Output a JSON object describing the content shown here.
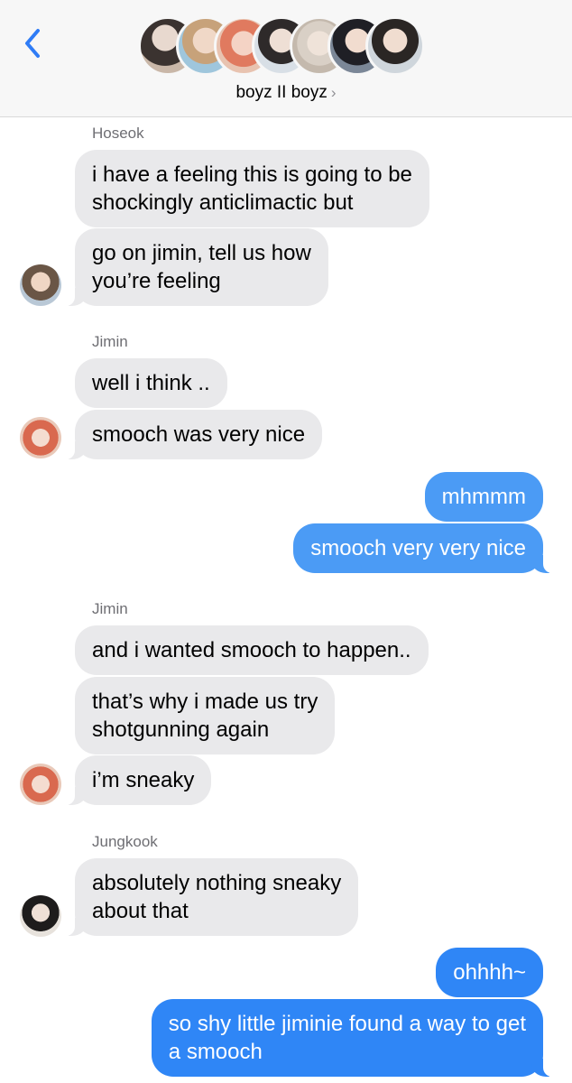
{
  "header": {
    "group_name": "boyz II boyz",
    "chevron": "›",
    "member_count": 7
  },
  "messages": [
    {
      "sender": "Hoseok",
      "text": "i have a feeling this is going to be\nshockingly anticlimactic but"
    },
    {
      "text": "go on jimin, tell us how\nyou’re feeling"
    },
    {
      "sender": "Jimin",
      "text": "well i think .."
    },
    {
      "text": "smooch was very nice"
    },
    {
      "outgoing": true,
      "text": "mhmmm"
    },
    {
      "outgoing": true,
      "text": "smooch very very nice"
    },
    {
      "sender": "Jimin",
      "text": "and i wanted smooch to happen.."
    },
    {
      "text": "that’s why i made us try\nshotgunning again"
    },
    {
      "text": "i’m sneaky"
    },
    {
      "sender": "Jungkook",
      "text": "absolutely nothing sneaky\nabout that"
    },
    {
      "outgoing": true,
      "text": "ohhhh~"
    },
    {
      "outgoing": true,
      "text": "so shy little jiminie found a way to get\na smooch"
    }
  ],
  "colors": {
    "incoming_bubble": "#e9e9eb",
    "outgoing_bubble": "#2f86f6",
    "accent": "#2f7cf6"
  }
}
